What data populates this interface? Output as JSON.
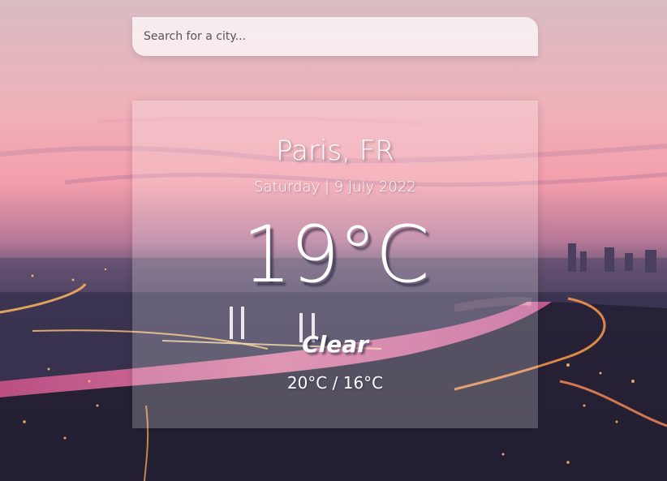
{
  "search": {
    "placeholder": "Search for a city..."
  },
  "weather": {
    "location": "Paris, FR",
    "date": "Saturday | 9 July 2022",
    "temperature": "19°C",
    "condition": "Clear",
    "hi_low": "20°C / 16°C"
  },
  "colors": {
    "sky_top": "#dcbcc4",
    "sky_mid": "#f2a6b0",
    "horizon": "#9b6a8e",
    "city_dark": "#2f2a42",
    "river": "#d96a9a",
    "lights": "#ffb65c",
    "card_glass": "rgba(255,255,255,0.22)",
    "text": "#ffffff"
  },
  "icons": {
    "background": "city-skyline-background"
  }
}
